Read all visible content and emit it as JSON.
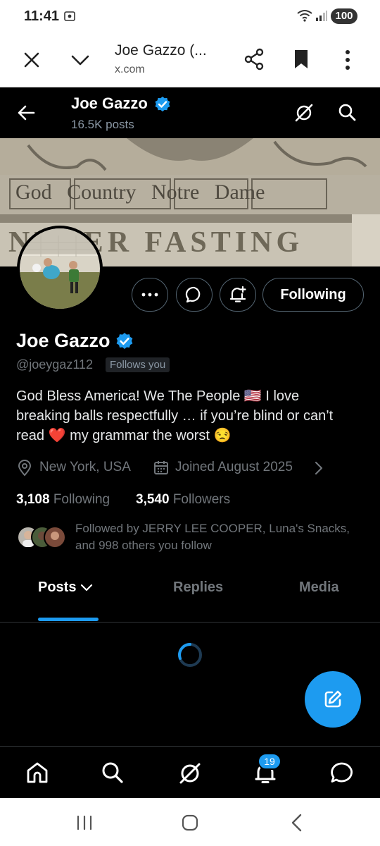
{
  "status_bar": {
    "time": "11:41",
    "battery": "100"
  },
  "browser": {
    "page_title": "Joe Gazzo (...",
    "domain": "x.com"
  },
  "header": {
    "name": "Joe Gazzo",
    "post_count": "16.5K posts"
  },
  "banner": {
    "carving_line1": "God Country Notre Dame",
    "carving_line2": "NEVER FASTING"
  },
  "actions": {
    "follow_label": "Following"
  },
  "profile": {
    "name": "Joe Gazzo",
    "handle": "@joeygaz112",
    "follows_you": "Follows you",
    "bio_line1_a": "God Bless America! We The People",
    "bio_flag": "🇺🇸",
    "bio_line1_b": "I love",
    "bio_line2": "breaking balls respectfully … if you’re blind or can’t",
    "bio_line3_a": "read",
    "bio_heart": "❤️",
    "bio_line3_b": "my grammar the worst",
    "bio_emoji": "😒",
    "location": "New York, USA",
    "joined": "Joined August 2025",
    "following_count": "3,108",
    "following_label": "Following",
    "followers_count": "3,540",
    "followers_label": "Followers",
    "followed_by_line1": "Followed by JERRY LEE COOPER, Luna's Snacks,",
    "followed_by_line2": "and 998 others you follow"
  },
  "tabs": [
    {
      "label": "Posts",
      "active": true
    },
    {
      "label": "Replies",
      "active": false
    },
    {
      "label": "Media",
      "active": false
    }
  ],
  "bottom_nav": {
    "notifications_badge": "19"
  },
  "colors": {
    "accent": "#1d9bf0",
    "background": "#000000",
    "muted": "#71767b"
  },
  "icons": [
    "close-icon",
    "chevron-down-icon",
    "share-icon",
    "bookmark-icon",
    "more-vert-icon",
    "back-arrow-icon",
    "verified-badge-icon",
    "grok-icon",
    "search-icon",
    "more-horiz-icon",
    "message-icon",
    "bell-plus-icon",
    "location-icon",
    "calendar-icon",
    "chevron-right-icon",
    "compose-icon",
    "home-icon",
    "bell-icon",
    "recent-apps-icon",
    "home-circle-icon",
    "back-icon"
  ]
}
